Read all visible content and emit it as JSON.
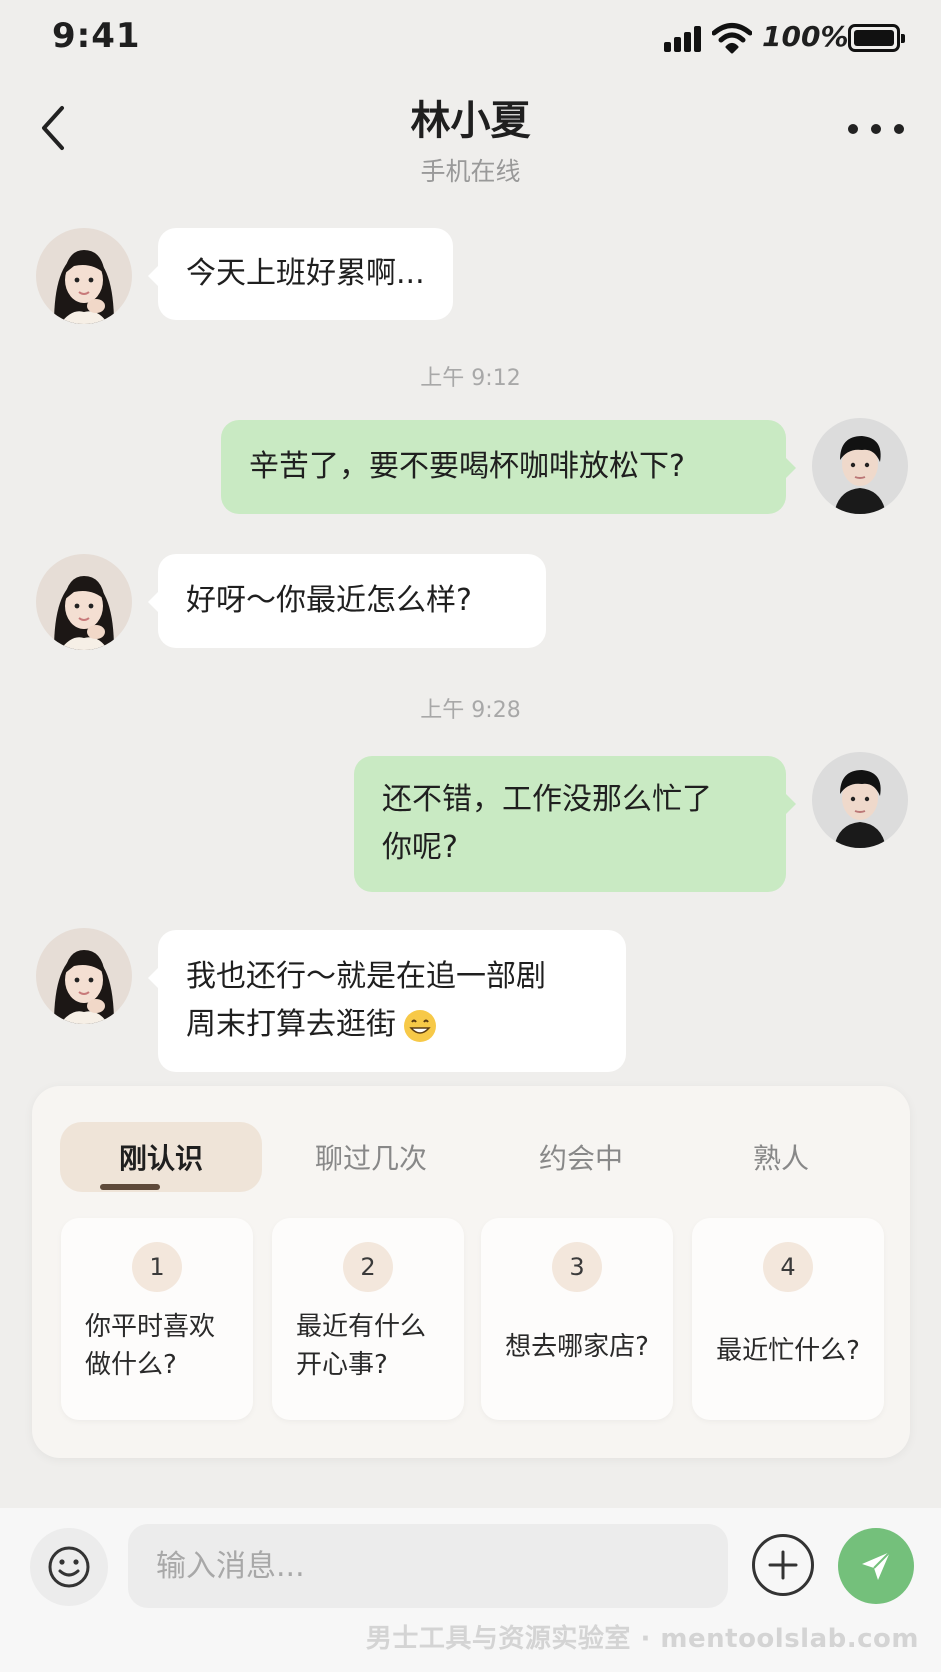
{
  "status_bar": {
    "time": "9:41",
    "battery": "100%"
  },
  "header": {
    "title": "林小夏",
    "subtitle": "手机在线"
  },
  "messages": [
    {
      "side": "in",
      "text": "今天上班好累啊..."
    },
    {
      "type": "time",
      "text": "上午 9:12"
    },
    {
      "side": "out",
      "text": "辛苦了，要不要喝杯咖啡放松下?"
    },
    {
      "side": "in",
      "text": "好呀～你最近怎么样?"
    },
    {
      "type": "time",
      "text": "上午 9:28"
    },
    {
      "side": "out",
      "line1": "还不错，工作没那么忙了",
      "line2": "你呢?"
    },
    {
      "side": "in",
      "line1": "我也还行～就是在追一部剧",
      "line2": "周末打算去逛街",
      "emoji": "grinning-face-icon"
    }
  ],
  "suggestions": {
    "tabs": [
      "刚认识",
      "聊过几次",
      "约会中",
      "熟人"
    ],
    "active_tab": "刚认识",
    "cards": [
      {
        "num": "1",
        "line1": "你平时喜欢",
        "line2": "做什么?"
      },
      {
        "num": "2",
        "line1": "最近有什么",
        "line2": "开心事?"
      },
      {
        "num": "3",
        "text": "想去哪家店?"
      },
      {
        "num": "4",
        "text": "最近忙什么?"
      }
    ]
  },
  "input": {
    "placeholder": "输入消息..."
  },
  "watermark": "男士工具与资源实验室 · mentoolslab.com",
  "colors": {
    "background": "#efeeec",
    "outgoing_bubble": "#c9eac3",
    "incoming_bubble": "#ffffff",
    "send_button": "#74c07b",
    "active_tab": "#efe4d8"
  },
  "icons": [
    "back-icon",
    "more-icon",
    "signal-icon",
    "wifi-icon",
    "battery-icon",
    "smiley-icon",
    "plus-icon",
    "send-icon"
  ]
}
